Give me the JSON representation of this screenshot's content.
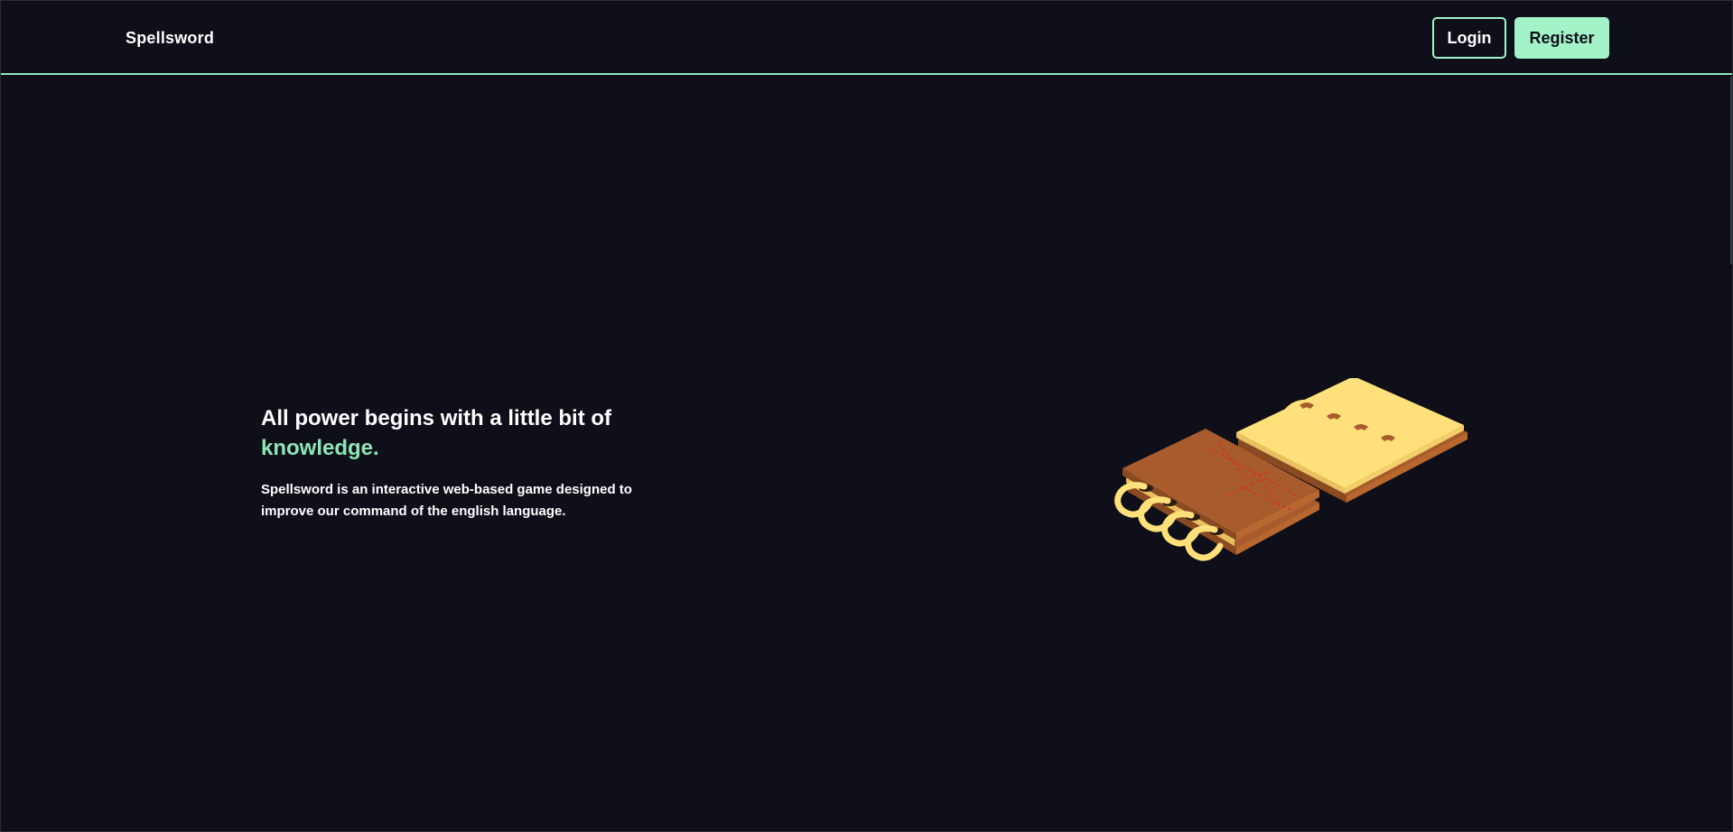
{
  "header": {
    "brand": "Spellsword",
    "login_label": "Login",
    "register_label": "Register"
  },
  "hero": {
    "headline_prefix": "All power begins with a little bit of",
    "headline_accent": "knowledge.",
    "description": "Spellsword is an interactive web-based game designed to improve our command of the english language."
  },
  "illustration": {
    "icon": "spellbook-illustration-icon"
  },
  "colors": {
    "background": "#0e0f18",
    "accent": "#8ee6b8",
    "button_fill": "#a3f3c9",
    "book_cover": "#a85c2e",
    "book_pages": "#ffe07a"
  }
}
